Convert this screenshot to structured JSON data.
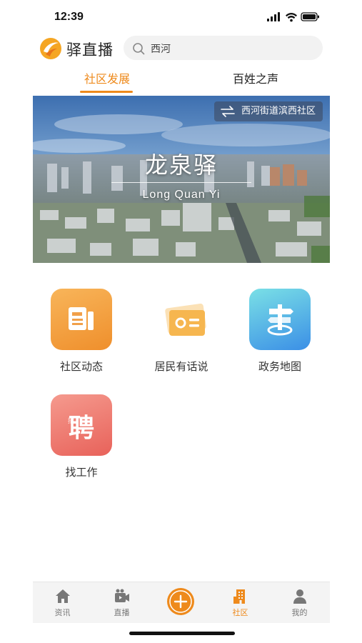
{
  "status_bar": {
    "time": "12:39"
  },
  "header": {
    "logo_text": "驿直播",
    "search_value": "西河"
  },
  "tabs": [
    {
      "label": "社区发展",
      "active": true
    },
    {
      "label": "百姓之声",
      "active": false
    }
  ],
  "banner": {
    "location": "西河街道滨西社区",
    "title": "龙泉驿",
    "subtitle": "Long Quan Yi"
  },
  "services": [
    {
      "label": "社区动态",
      "icon": "news-icon"
    },
    {
      "label": "居民有话说",
      "icon": "radio-icon"
    },
    {
      "label": "政务地图",
      "icon": "signpost-icon"
    },
    {
      "label": "找工作",
      "icon": "hire-icon",
      "glyph": "聘",
      "glyph_small": "招"
    }
  ],
  "bottom_nav": [
    {
      "label": "资讯",
      "icon": "home-icon"
    },
    {
      "label": "直播",
      "icon": "video-icon"
    },
    {
      "label": "",
      "icon": "plus-icon"
    },
    {
      "label": "社区",
      "icon": "building-icon",
      "active": true
    },
    {
      "label": "我的",
      "icon": "person-icon"
    }
  ],
  "colors": {
    "accent": "#ee8a1c",
    "text": "#222222",
    "muted": "#777777"
  }
}
